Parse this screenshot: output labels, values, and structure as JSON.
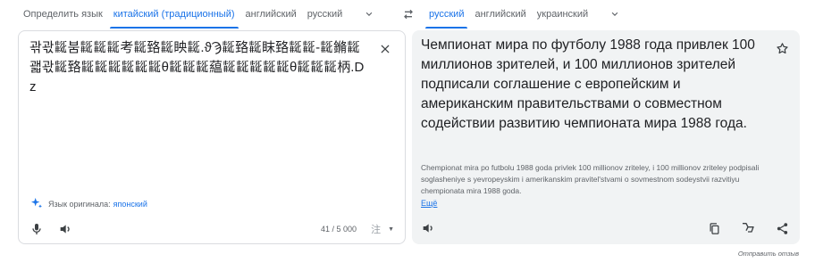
{
  "source_langs": {
    "detect": "Определить язык",
    "tabs": [
      "китайский (традиционный)",
      "английский",
      "русский"
    ],
    "active_index": 0
  },
  "target_langs": {
    "tabs": [
      "русский",
      "английский",
      "украинский"
    ],
    "active_index": 0
  },
  "source": {
    "text": "곾곿𘚶붐𘚶𘚶𘚶考𘚶臵𘚶眏𘚶.ϑϠ𘚶臵𘚶眜臵𘚶𘚶-𘚶鏅𘚶괣곿𘚶臵𘚶𘚶𘚶𘚶𘚶𘚶θ𘚶𘚶𘚶藴𘚶𘚶𘚶𘚶𘚶θ𘚶𘚶𘚶柄.Dz",
    "detected_label": "Язык оригинала:",
    "detected_lang": "японский",
    "counter": "41 / 5 000",
    "ime": "注"
  },
  "target": {
    "text": "Чемпионат мира по футболу 1988 года привлек 100 миллионов зрителей, и 100 миллионов зрителей подписали соглашение с европейским и американским правительствами о совместном содействии развитию чемпионата мира 1988 года.",
    "transliteration": "Chempionat mira po futbolu 1988 goda privlek 100 millionov zriteley, i 100 millionov zriteley podpisali soglasheniye s yevropeyskim i amerikanskim pravitel'stvami o sovmestnom sodeystvii razvitiyu chempionata mira 1988 goda.",
    "more": "Ещё"
  },
  "feedback": "Отправить отзыв",
  "colors": {
    "accent": "#1a73e8",
    "panel_bg": "#f1f3f4",
    "muted": "#5f6368"
  }
}
